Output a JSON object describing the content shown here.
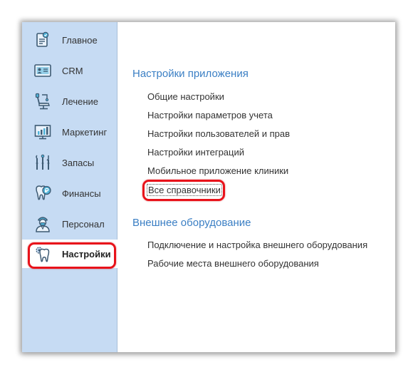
{
  "sidebar": {
    "items": [
      {
        "label": "Главное",
        "icon": "home-clipboard-icon"
      },
      {
        "label": "CRM",
        "icon": "crm-card-icon"
      },
      {
        "label": "Лечение",
        "icon": "dental-chair-icon"
      },
      {
        "label": "Маркетинг",
        "icon": "marketing-chart-icon"
      },
      {
        "label": "Запасы",
        "icon": "dental-tools-icon"
      },
      {
        "label": "Финансы",
        "icon": "tooth-coin-icon"
      },
      {
        "label": "Персонал",
        "icon": "doctor-icon"
      },
      {
        "label": "Настройки",
        "icon": "tooth-gear-icon"
      }
    ],
    "active_index": 7
  },
  "main": {
    "sections": [
      {
        "title": "Настройки приложения",
        "links": [
          "Общие настройки",
          "Настройки параметров учета",
          "Настройки пользователей и прав",
          "Настройки интеграций",
          "Мобильное приложение клиники",
          "Все справочники"
        ]
      },
      {
        "title": "Внешнее оборудование",
        "links": [
          "Подключение и настройка внешнего оборудования",
          "Рабочие места внешнего оборудования"
        ]
      }
    ]
  },
  "colors": {
    "sidebar_bg": "#c6dbf3",
    "section_title": "#3b7fc4",
    "highlight": "#e8121a",
    "icon_stroke": "#3d5a73",
    "icon_accent": "#4fb3d9"
  }
}
